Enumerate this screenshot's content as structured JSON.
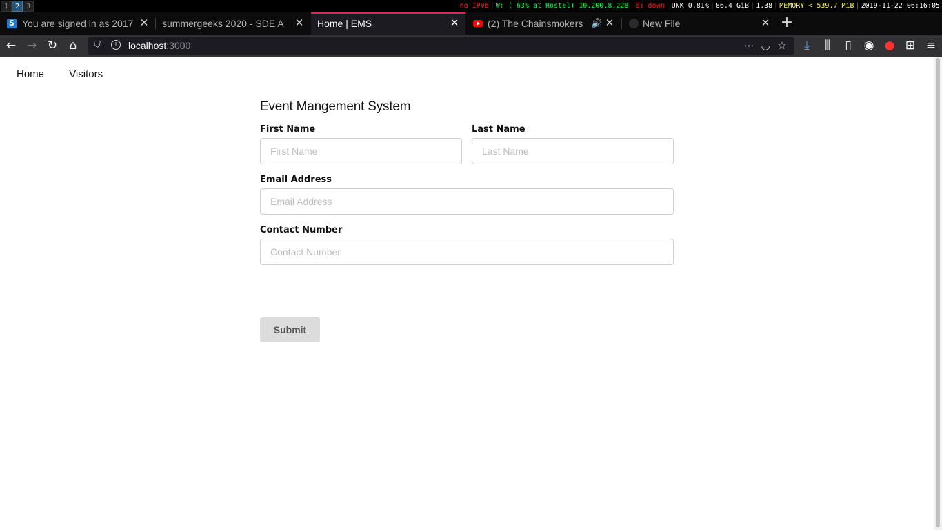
{
  "statusbar": {
    "workspaces": [
      "1",
      "2",
      "3"
    ],
    "active_workspace": "2",
    "ipv6": "no IPv6",
    "wifi": "W: ( 63% at Hostel) 10.200.8.228",
    "ethernet": "E: down",
    "cpu": "UNK 0.81%",
    "disk": "86.4 GiB",
    "load": "1.38",
    "memory": "MEMORY < 539.7 MiB",
    "datetime": "2019-11-22 06:16:05"
  },
  "tabs": [
    {
      "title": "You are signed in as 2017",
      "favicon": "s-icon"
    },
    {
      "title": "summergeeks 2020 - SDE A",
      "favicon": ""
    },
    {
      "title": "Home | EMS",
      "favicon": "",
      "active": true
    },
    {
      "title": "(2) The Chainsmokers",
      "favicon": "youtube-icon",
      "audio": true
    },
    {
      "title": "New File",
      "favicon": "github-icon"
    }
  ],
  "urlbar": {
    "host": "localhost",
    "port": ":3000"
  },
  "site": {
    "nav": [
      "Home",
      "Visitors"
    ],
    "title": "Event Mangement System",
    "form": {
      "first_name_label": "First Name",
      "first_name_placeholder": "First Name",
      "last_name_label": "Last Name",
      "last_name_placeholder": "Last Name",
      "email_label": "Email Address",
      "email_placeholder": "Email Address",
      "contact_label": "Contact Number",
      "contact_placeholder": "Contact Number",
      "submit_label": "Submit"
    }
  },
  "colors": {
    "active_tab_accent": "#e22850",
    "submit_bg": "#dcdcdc"
  }
}
